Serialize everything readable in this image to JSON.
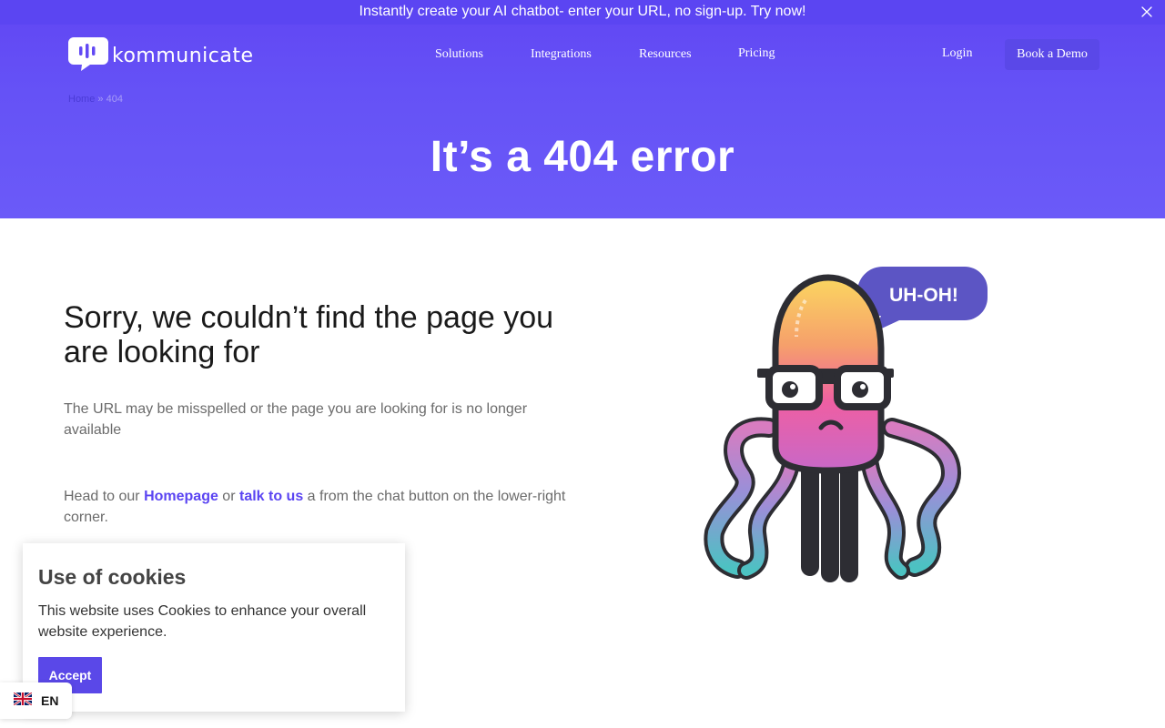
{
  "announcement": {
    "text": "Instantly create your AI chatbot- enter your URL, no sign-up. Try now!"
  },
  "brand": {
    "name": "kommunicate",
    "accent": "#5b45f2"
  },
  "nav": {
    "items": [
      {
        "label": "Solutions"
      },
      {
        "label": "Integrations"
      },
      {
        "label": "Resources"
      },
      {
        "label": "Pricing"
      }
    ],
    "login": "Login",
    "cta": "Book a Demo"
  },
  "breadcrumb": {
    "home": "Home",
    "separator": "»",
    "current": "404"
  },
  "hero": {
    "title": "It’s a 404 error"
  },
  "main": {
    "heading": "Sorry, we couldn’t find the page you are looking for",
    "paragraph1": "The URL may be misspelled or the page you are looking for is no longer available",
    "paragraph2": {
      "prefix": "Head to our ",
      "homepage_link": "Homepage",
      "middle": " or ",
      "talk_link": "talk to us",
      "suffix": " a from the chat button on the lower-right corner."
    },
    "illustration": {
      "bubble_text": "UH-OH!"
    }
  },
  "cookie": {
    "title": "Use of cookies",
    "text": "This website uses Cookies to enhance your overall website experience.",
    "accept": "Accept"
  },
  "language": {
    "code": "EN"
  }
}
